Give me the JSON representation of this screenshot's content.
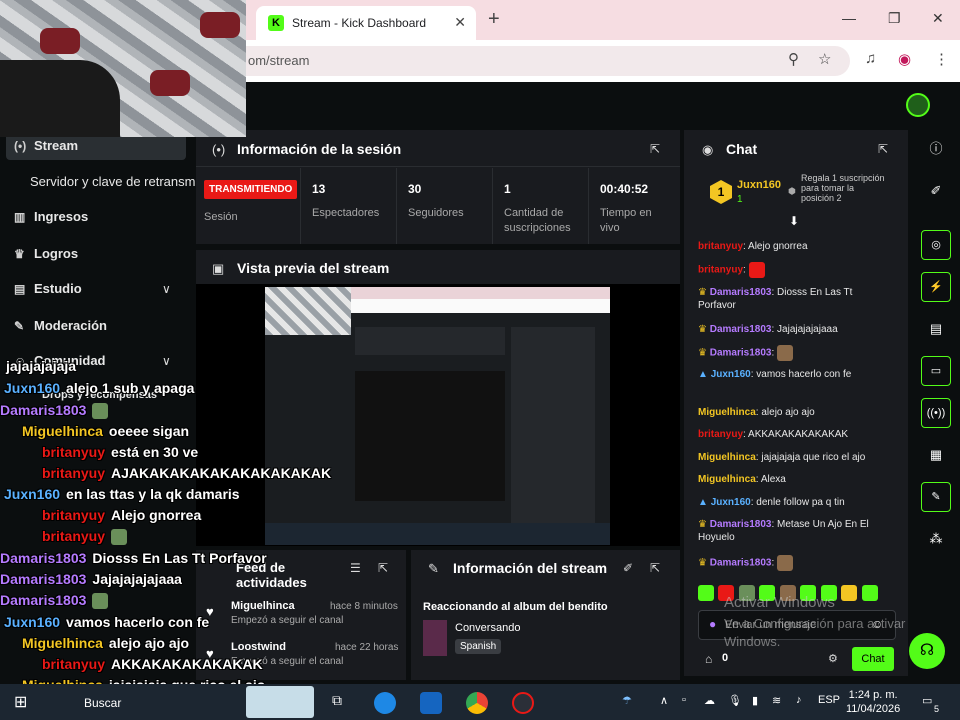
{
  "browser": {
    "tab_title": "Stream - Kick Dashboard",
    "favicon_letter": "K",
    "url": "om/stream",
    "new_tab": "+",
    "minimize": "—",
    "maximize": "❐",
    "close": "✕"
  },
  "sidebar": {
    "stream": "Stream",
    "server_key": "Servidor y clave de retransm",
    "income": "Ingresos",
    "achievements": "Logros",
    "studio": "Estudio",
    "moderation": "Moderación",
    "community": "Comunidad",
    "drops": "Drops y recompensas"
  },
  "session": {
    "title": "Información de la sesión",
    "status_badge": "TRANSMITIENDO",
    "status_label": "Sesión",
    "viewers_value": "13",
    "viewers_label": "Espectadores",
    "followers_value": "30",
    "followers_label": "Seguidores",
    "subs_value": "1",
    "subs_label": "Cantidad de suscripciones",
    "time_value": "00:40:52",
    "time_label": "Tiempo en vivo"
  },
  "preview": {
    "title": "Vista previa del stream"
  },
  "activity": {
    "title": "Feed de actividades",
    "items": [
      {
        "user": "Miguelhinca",
        "action": "Empezó a seguir el canal",
        "time": "hace 8 minutos"
      },
      {
        "user": "Loostwind",
        "action": "Empezó a seguir el canal",
        "time": "hace 22 horas"
      }
    ]
  },
  "stream_info": {
    "title": "Información del stream",
    "stream_title": "Reaccionando al album del bendito",
    "category": "Conversando",
    "language": "Spanish"
  },
  "chat": {
    "title": "Chat",
    "top_user": "Juxn160",
    "top_rank": "1",
    "top_count": "1",
    "gift_text": "Regala 1 suscripción para tomar la posición 2",
    "messages": [
      {
        "user": "britanyuy",
        "text": "Alejo gnorrea"
      },
      {
        "user": "britanyuy",
        "text": ""
      },
      {
        "user": "Damaris1803",
        "text": "Diosss En Las Tt Porfavor"
      },
      {
        "user": "Damaris1803",
        "text": "Jajajajajajaaa"
      },
      {
        "user": "Damaris1803",
        "text": ""
      },
      {
        "user": "Juxn160",
        "text": "vamos hacerlo con fe"
      },
      {
        "user": "Miguelhinca",
        "text": "alejo ajo ajo"
      },
      {
        "user": "britanyuy",
        "text": "AKKAKAKAKAKAKAK"
      },
      {
        "user": "Miguelhinca",
        "text": "jajajajaja que rico el ajo"
      },
      {
        "user": "Miguelhinca",
        "text": "Alexa"
      },
      {
        "user": "Juxn160",
        "text": "denle follow pa q tin"
      },
      {
        "user": "Damaris1803",
        "text": "Metase Un Ajo En El Hoyuelo"
      },
      {
        "user": "Damaris1803",
        "text": ""
      }
    ],
    "input_placeholder": "Enviar un mensaje",
    "points": "0",
    "send": "Chat"
  },
  "overlay": {
    "lines": [
      {
        "user": "",
        "text": "jajajajajaja"
      },
      {
        "user": "Juxn160",
        "text": "alejo 1 sub y apaga"
      },
      {
        "user": "Damaris1803",
        "text": ""
      },
      {
        "user": "Miguelhinca",
        "text": "oeeee sigan"
      },
      {
        "user": "britanyuy",
        "text": "está en 30 ve"
      },
      {
        "user": "britanyuy",
        "text": "AJAKAKAKAKAKAKAKAKAKAK"
      },
      {
        "user": "Juxn160",
        "text": "en las ttas y la qk damaris"
      },
      {
        "user": "britanyuy",
        "text": "Alejo gnorrea"
      },
      {
        "user": "britanyuy",
        "text": ""
      },
      {
        "user": "Damaris1803",
        "text": "Diosss En Las Tt Porfavor"
      },
      {
        "user": "Damaris1803",
        "text": "Jajajajajajaaa"
      },
      {
        "user": "Damaris1803",
        "text": ""
      },
      {
        "user": "Juxn160",
        "text": "vamos hacerlo con fe"
      },
      {
        "user": "Miguelhinca",
        "text": "alejo ajo ajo"
      },
      {
        "user": "britanyuy",
        "text": "AKKAKAKAKAKAKAK"
      },
      {
        "user": "Miguelhinca",
        "text": "jajajajaja que rico el ajo"
      },
      {
        "user": "Miguelhinca",
        "text": "Alexa"
      }
    ]
  },
  "watermark": {
    "line1": "Activar Windows",
    "line2": "Ve a Configuración para activar",
    "line3": "Windows."
  },
  "taskbar": {
    "search": "Buscar",
    "lang": "ESP",
    "time": "1:24 p. m.",
    "date": "11/04/2026",
    "notifications": "5"
  },
  "colors": {
    "kick_green": "#53fc18",
    "live_red": "#e91916",
    "user_britanyuy": "#e91916",
    "user_damaris": "#b57bff",
    "user_juxn": "#5ab1ff",
    "user_miguel": "#f3c623"
  }
}
